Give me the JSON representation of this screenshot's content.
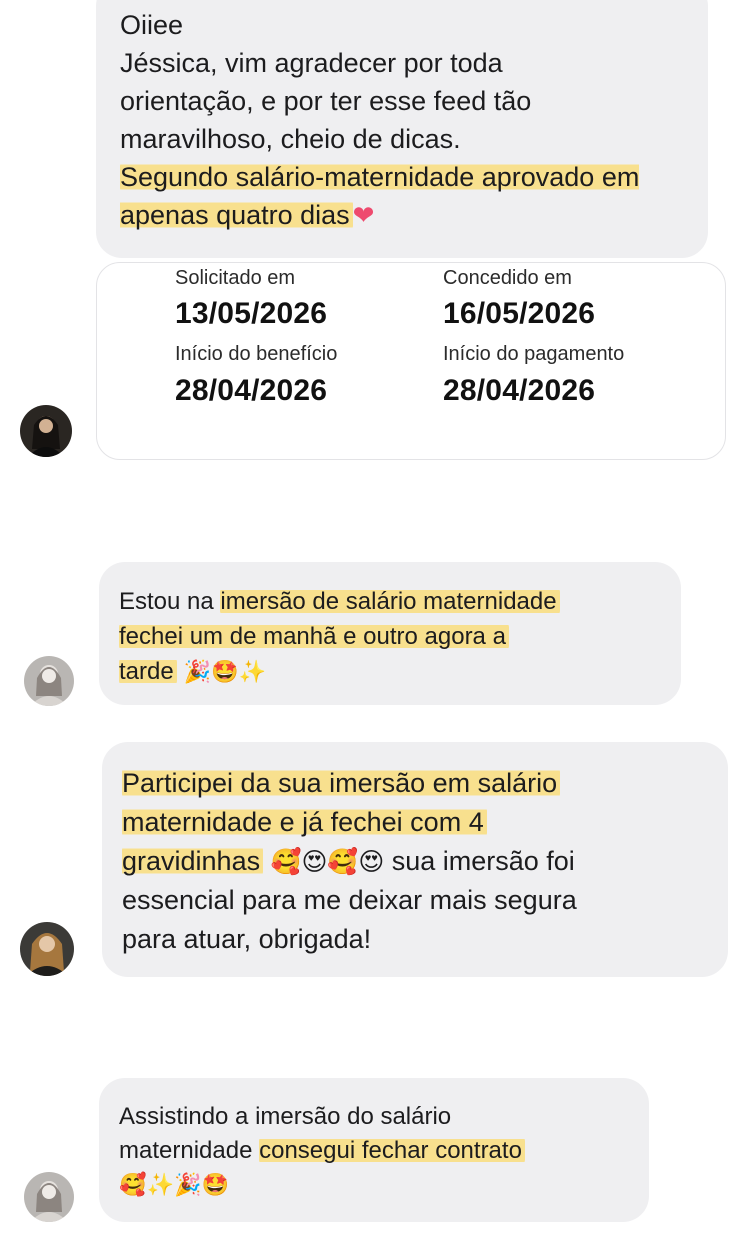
{
  "message1": {
    "line1": "Oiiee",
    "body": "Jéssica, vim agradecer por toda orientação, e por ter esse feed tão maravilhoso, cheio de dicas.",
    "highlight": "Segundo salário-maternidade aprovado em apenas quatro dias",
    "emoji": "❤"
  },
  "benefit_card": {
    "solicitado_label": "Solicitado em",
    "solicitado_value": "13/05/2026",
    "concedido_label": "Concedido em",
    "concedido_value": "16/05/2026",
    "inicio_beneficio_label": "Início do benefício",
    "inicio_beneficio_value": "28/04/2026",
    "inicio_pagamento_label": "Início do pagamento",
    "inicio_pagamento_value": "28/04/2026"
  },
  "message2": {
    "plain": "Estou na ",
    "highlight_a": "imersão de salário maternidade",
    "highlight_b": "fechei um de manhã e outro agora a",
    "highlight_c": "tarde",
    "emojis": " 🎉🤩✨"
  },
  "message3": {
    "highlight_a": "Participei da sua imersão em salário",
    "highlight_b": "maternidade e já fechei com 4",
    "highlight_c": "gravidinhas",
    "emojis": "🥰😍🥰😍",
    "rest_a": " sua imersão foi",
    "rest_b": "essencial para me deixar mais segura",
    "rest_c": "para atuar, obrigada!"
  },
  "message4": {
    "plain_a": "Assistindo a imersão do salário",
    "plain_b": "maternidade ",
    "highlight": "consegui fechar contrato",
    "emojis": "🥰✨🎉🤩"
  },
  "icons": [
    "avatar-icon",
    "heart-icon"
  ]
}
